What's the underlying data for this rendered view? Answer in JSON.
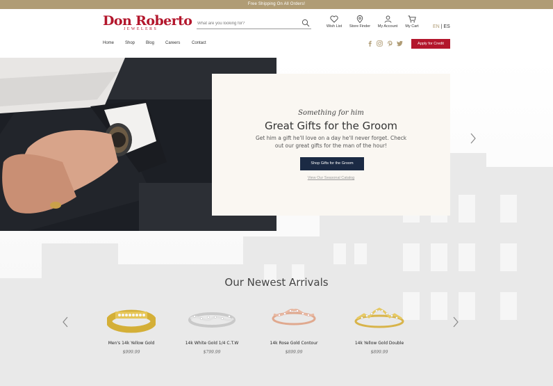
{
  "promo": {
    "text": "Free Shipping On All Orders!"
  },
  "brand": {
    "name": "Don Roberto",
    "sub": "JEWELERS",
    "accent": "#b3162c",
    "gold": "#b09c75"
  },
  "search": {
    "placeholder": "What are you looking for?",
    "icon": "search-icon"
  },
  "header_icons": [
    {
      "label": "Wish List",
      "icon": "heart-icon"
    },
    {
      "label": "Store Finder",
      "icon": "map-pin-icon"
    },
    {
      "label": "My Account",
      "icon": "user-icon"
    },
    {
      "label": "My Cart",
      "icon": "cart-icon"
    }
  ],
  "language": {
    "en": "EN",
    "sep": "|",
    "es": "ES"
  },
  "nav": [
    "Home",
    "Shop",
    "Blog",
    "Careers",
    "Contact"
  ],
  "social": [
    "facebook-icon",
    "instagram-icon",
    "pinterest-icon",
    "twitter-icon"
  ],
  "credit_button": "Apply for Credit",
  "hero": {
    "script": "Something for him",
    "title": "Great Gifts for the Groom",
    "text": "Get him a gift he'll love on a day he'll never forget. Check out our great gifts for the man of the hour!",
    "button": "Shop Gifts for the Groom",
    "link": "View Our Seasonal Catalog",
    "button_color": "#1b2a44"
  },
  "arrivals": {
    "title": "Our Newest Arrivals",
    "products": [
      {
        "name": "Men's 14k Yellow Gold",
        "price": "$999.99",
        "metal": "yellow"
      },
      {
        "name": "14k White Gold 1/4 C.T.W",
        "price": "$799.99",
        "metal": "white"
      },
      {
        "name": "14k Rose Gold Contour",
        "price": "$899.99",
        "metal": "rose"
      },
      {
        "name": "14k Yellow Gold Double",
        "price": "$899.99",
        "metal": "yellow"
      }
    ]
  }
}
